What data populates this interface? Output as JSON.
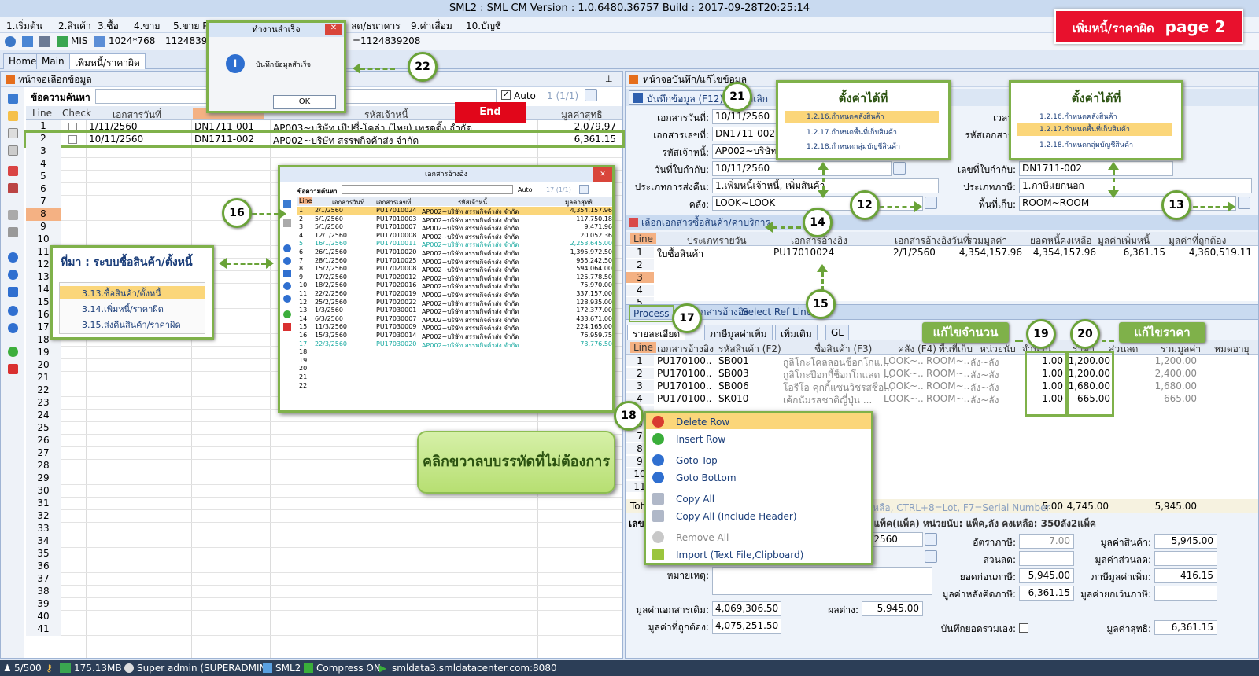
{
  "window": {
    "title": "SML2 : SML CM Version : 1.0.6480.36757  Build : 2017-09-28T20:25:14"
  },
  "banner": {
    "thai": "เพิ่มหนี้/ราคาผิด",
    "page": "page 2"
  },
  "menu": [
    "1.เริ่มต้น",
    "2.สินค้า",
    "3.ซื้อ",
    "4.ขาย",
    "5.ขาย P",
    "ลด/ธนาคาร",
    "9.ค่าเสื่อม",
    "10.บัญชี"
  ],
  "toolbar": {
    "mis": "MIS",
    "resolution": "1024*768",
    "id_a": "1124839",
    "id_b": "=1124839208"
  },
  "tabs": [
    "Home",
    "Main",
    "เพิ่มหนี้/ราคาผิด"
  ],
  "left": {
    "header": "หน้าจอเลือกข้อมูล",
    "search_label": "ข้อความค้นหา",
    "search_value": "",
    "auto_label": "Auto",
    "page_info": "1 (1/1)",
    "columns": [
      "Line",
      "Check",
      "เอกสารวันที่",
      "",
      "รหัสเจ้าหนี้",
      "มูลค่าสุทธิ"
    ],
    "rows": [
      {
        "line": "1",
        "date": "1/11/2560",
        "doc": "DN1711-001",
        "creditor": "AP003~บริษัท เป๊ปซี่-โคล่า (ไทย) เทรดดิ้ง จำกัด",
        "amount": "2,079.97"
      },
      {
        "line": "2",
        "date": "10/11/2560",
        "doc": "DN1711-002",
        "creditor": "AP002~บริษัท สรรพกิจค้าส่ง จำกัด",
        "amount": "6,361.15"
      }
    ],
    "line_numbers": [
      "3",
      "4",
      "5",
      "6",
      "7",
      "8",
      "9",
      "10",
      "11",
      "12",
      "13",
      "14",
      "15",
      "16",
      "17",
      "18",
      "19",
      "20",
      "21",
      "22",
      "23",
      "24",
      "25",
      "26",
      "27",
      "28",
      "29",
      "30",
      "31",
      "32",
      "33",
      "34",
      "35",
      "36",
      "37",
      "38",
      "39",
      "40",
      "41"
    ]
  },
  "dialog": {
    "title": "ทำงานสำเร็จ",
    "message": "บันทึกข้อมูลสำเร็จ",
    "ok": "OK"
  },
  "end_label": "End",
  "popup": {
    "title": "เอกสารอ้างอิง",
    "search_label": "ข้อความค้นหา",
    "auto_label": "Auto",
    "page_info": "17 (1/1)",
    "columns": [
      "Line",
      "เอกสารวันที่",
      "เอกสารเลขที่",
      "รหัสเจ้าหนี้",
      "มูลค่าสุทธิ"
    ],
    "rows": [
      [
        "1",
        "2/1/2560",
        "PU17010024",
        "AP002~บริษัท สรรพกิจค้าส่ง จำกัด",
        "4,354,157.96"
      ],
      [
        "2",
        "5/1/2560",
        "PU17010003",
        "AP002~บริษัท สรรพกิจค้าส่ง จำกัด",
        "117,750.18"
      ],
      [
        "3",
        "5/1/2560",
        "PU17010007",
        "AP002~บริษัท สรรพกิจค้าส่ง จำกัด",
        "9,471.96"
      ],
      [
        "4",
        "12/1/2560",
        "PU17010008",
        "AP002~บริษัท สรรพกิจค้าส่ง จำกัด",
        "20,052.36"
      ],
      [
        "5",
        "16/1/2560",
        "PU17010011",
        "AP002~บริษัท สรรพกิจค้าส่ง จำกัด",
        "2,253,645.00"
      ],
      [
        "6",
        "26/1/2560",
        "PU17010020",
        "AP002~บริษัท สรรพกิจค้าส่ง จำกัด",
        "1,395,972.50"
      ],
      [
        "7",
        "28/1/2560",
        "PU17010025",
        "AP002~บริษัท สรรพกิจค้าส่ง จำกัด",
        "955,242.50"
      ],
      [
        "8",
        "15/2/2560",
        "PU17020008",
        "AP002~บริษัท สรรพกิจค้าส่ง จำกัด",
        "594,064.00"
      ],
      [
        "9",
        "17/2/2560",
        "PU17020012",
        "AP002~บริษัท สรรพกิจค้าส่ง จำกัด",
        "125,778.50"
      ],
      [
        "10",
        "18/2/2560",
        "PU17020016",
        "AP002~บริษัท สรรพกิจค้าส่ง จำกัด",
        "75,970.00"
      ],
      [
        "11",
        "22/2/2560",
        "PU17020019",
        "AP002~บริษัท สรรพกิจค้าส่ง จำกัด",
        "337,157.00"
      ],
      [
        "12",
        "25/2/2560",
        "PU17020022",
        "AP002~บริษัท สรรพกิจค้าส่ง จำกัด",
        "128,935.00"
      ],
      [
        "13",
        "1/3/2560",
        "PU17030001",
        "AP002~บริษัท สรรพกิจค้าส่ง จำกัด",
        "172,377.00"
      ],
      [
        "14",
        "6/3/2560",
        "PU17030007",
        "AP002~บริษัท สรรพกิจค้าส่ง จำกัด",
        "433,671.00"
      ],
      [
        "15",
        "11/3/2560",
        "PU17030009",
        "AP002~บริษัท สรรพกิจค้าส่ง จำกัด",
        "224,165.00"
      ],
      [
        "16",
        "15/3/2560",
        "PU17030014",
        "AP002~บริษัท สรรพกิจค้าส่ง จำกัด",
        "76,959.75"
      ],
      [
        "17",
        "22/3/2560",
        "PU17030020",
        "AP002~บริษัท สรรพกิจค้าส่ง จำกัด",
        "73,776.50"
      ]
    ],
    "empty_lines": [
      "18",
      "19",
      "20",
      "21",
      "22"
    ]
  },
  "source_box": {
    "title": "ที่มา : ระบบซื้อสินค้า/ตั้งหนี้",
    "items": [
      "3.13.ซื้อสินค้า/ตั้งหนี้",
      "3.14.เพิ่มหนี้/ราคาผิด",
      "3.15.ส่งคืนสินค้า/ราคาผิด"
    ]
  },
  "right": {
    "header": "หน้าจอบันทึก/แก้ไขข้อมูล",
    "save_button": "บันทึกข้อมูล (F12)",
    "cancel_fragment": "ยกเลิก",
    "fields": {
      "doc_date_label": "เอกสารวันที่:",
      "doc_date": "10/11/2560",
      "doc_no_label": "เอกสารเลขที่:",
      "doc_no": "DN1711-002",
      "creditor_label": "รหัสเจ้าหนี้:",
      "creditor": "AP002~บริษัท สรรพ",
      "inv_date_label": "วันที่ใบกำกับ:",
      "inv_date": "10/11/2560",
      "return_type_label": "ประเภทการส่งคืน:",
      "return_type": "1.เพิ่มหนี้เจ้าหนี้, เพิ่มสินค้า",
      "warehouse_label": "คลัง:",
      "warehouse": "LOOK~LOOK",
      "time_label": "เวลา:",
      "doc_code_label": "รหัสเอกสาร:",
      "inv_no_label": "เลขที่ใบกำกับ:",
      "inv_no": "DN1711-002",
      "tax_type_label": "ประเภทภาษี:",
      "tax_type": "1.ภาษีแยกนอก",
      "location_label": "พื้นที่เก็บ:",
      "location": "ROOM~ROOM"
    },
    "ref_section": "เลือกเอกสารซื้อสินค้า/ค่าบริการ",
    "ref_columns": [
      "Line",
      "ประเภทรายวัน",
      "เอกสารอ้างอิง",
      "เอกสารอ้างอิงวันที่",
      "รวมมูลค่า",
      "ยอดหนี้คงเหลือ",
      "มูลค่าเพิ่มหนี้",
      "มูลค่าที่ถูกต้อง"
    ],
    "ref_row": {
      "line": "1",
      "type": "ใบซื้อสินค้า",
      "ref": "PU17010024",
      "date": "2/1/2560",
      "total": "4,354,157.96",
      "balance": "4,354,157.96",
      "add": "6,361.15",
      "correct": "4,360,519.11"
    },
    "ref_lines": [
      "2",
      "3",
      "4",
      "5"
    ],
    "process_tabs": [
      "Process",
      "เอกสารอ้างอิง",
      "Select Ref Line"
    ],
    "detail_tabs": [
      "รายละเอียด",
      "ภาษีมูลค่าเพิ่ม",
      "เพิ่มเติม",
      "GL"
    ],
    "item_columns": [
      "Line",
      "เอกสารอ้างอิง",
      "รหัสสินค้า (F2)",
      "ชื่อสินค้า (F3)",
      "คลัง (F4)",
      "พื้นที่เก็บ",
      "หน่วยนับ",
      "จำนวน",
      "ราคา",
      "ส่วนลด",
      "รวมมูลค่า",
      "หมดอายุ"
    ],
    "items": [
      {
        "line": "1",
        "ref": "PU170100..",
        "code": "SB001",
        "name": "กูลิโกะโคลลอนช็อกโกแ...",
        "wh": "LOOK~...",
        "loc": "ROOM~...",
        "unit": "ลัง~ลัง",
        "qty": "1.00",
        "price": "1,200.00",
        "total": "1,200.00"
      },
      {
        "line": "2",
        "ref": "PU170100..",
        "code": "SB003",
        "name": "กูลิโกะป๊อกกี้ช็อกโกแลต ...",
        "wh": "LOOK~...",
        "loc": "ROOM~...",
        "unit": "ลัง~ลัง",
        "qty": "1.00",
        "price": "1,200.00",
        "total": "2,400.00"
      },
      {
        "line": "3",
        "ref": "PU170100..",
        "code": "SB006",
        "name": "โอรีโอ คุกกี้แซนวิชรสช็อ...",
        "wh": "LOOK~...",
        "loc": "ROOM~...",
        "unit": "ลัง~ลัง",
        "qty": "1.00",
        "price": "1,680.00",
        "total": "1,680.00"
      },
      {
        "line": "4",
        "ref": "PU170100..",
        "code": "SK010",
        "name": "เค้กนั่มรสชาติญี่ปุ่น ...",
        "wh": "LOOK~...",
        "loc": "ROOM~...",
        "unit": "ลัง~ลัง",
        "qty": "1.00",
        "price": "665.00",
        "total": "665.00"
      }
    ],
    "item_lines_extra": [
      "5",
      "6",
      "7",
      "8",
      "9",
      "10",
      "11"
    ],
    "totals_label": "Tot",
    "total_qty": "5.00",
    "total_price": "4,745.00",
    "total_amount": "5,945.00",
    "hint": "เหลือ, CTRL+8=Lot, F7=Serial Number",
    "stock_info": ".00 แพ็ค(แพ็ค) หน่วยนับ: แพ็ค,ลัง คงเหลือ: 350ลัง2แพ็ค",
    "doc_date2": "11/2560",
    "summary": {
      "tax_rate_label": "อัตราภาษี:",
      "tax_rate": "7.00",
      "discount_label": "ส่วนลด:",
      "discount": "",
      "before_tax_label": "ยอดก่อนภาษี:",
      "before_tax": "5,945.00",
      "after_discount_label": "มูลค่าหลังคิดภาษี:",
      "after_discount": "6,361.15",
      "goods_value_label": "มูลค่าสินค้า:",
      "goods_value": "5,945.00",
      "disc_value_label": "มูลค่าส่วนลด:",
      "disc_value": "",
      "vat_label": "ภาษีมูลค่าเพิ่ม:",
      "vat": "416.15",
      "exempt_label": "มูลค่ายกเว้นภาษี:",
      "exempt": "",
      "remark_label": "หมายเหตุ:",
      "orig_value_label": "มูลค่าเอกสารเดิม:",
      "orig_value": "4,069,306.50",
      "correct_value_label": "มูลค่าที่ถูกต้อง:",
      "correct_value": "4,075,251.50",
      "diff_label": "ผลต่าง:",
      "diff": "5,945.00",
      "manual_total_label": "บันทึกยอดรวมเอง:",
      "net_label": "มูลค่าสุทธิ:",
      "net": "6,361.15",
      "e_label": "เลข"
    }
  },
  "context_menu": [
    "Delete Row",
    "Insert Row",
    "Goto Top",
    "Goto Bottom",
    "Copy All",
    "Copy All (Include Header)",
    "Remove All",
    "Import (Text File,Clipboard)"
  ],
  "bubble_text": "คลิกขวาลบบรรทัดที่ไม่ต้องการ",
  "setting_boxes": {
    "title": "ตั้งค่าได้ที่",
    "left_items": [
      "1.2.16.กำหนดคลังสินค้า",
      "1.2.17.กำหนดพื้นที่เก็บสินค้า",
      "1.2.18.กำหนดกลุ่มบัญชีสินค้า"
    ],
    "right_items": [
      "1.2.16.กำหนดคลังสินค้า",
      "1.2.17.กำหนดพื้นที่เก็บสินค้า",
      "1.2.18.กำหนดกลุ่มบัญชีสินค้า"
    ]
  },
  "edit_labels": {
    "qty": "แก้ไขจำนวน",
    "price": "แก้ไขราคา"
  },
  "callouts": [
    "12",
    "13",
    "14",
    "15",
    "16",
    "17",
    "18",
    "19",
    "20",
    "21",
    "22"
  ],
  "status": {
    "count": "5/500",
    "memory": "175.13MB",
    "user": "Super admin (SUPERADMIN)",
    "db": "SML2",
    "compress": "Compress ON",
    "server": "smldata3.smldatacenter.com:8080"
  }
}
